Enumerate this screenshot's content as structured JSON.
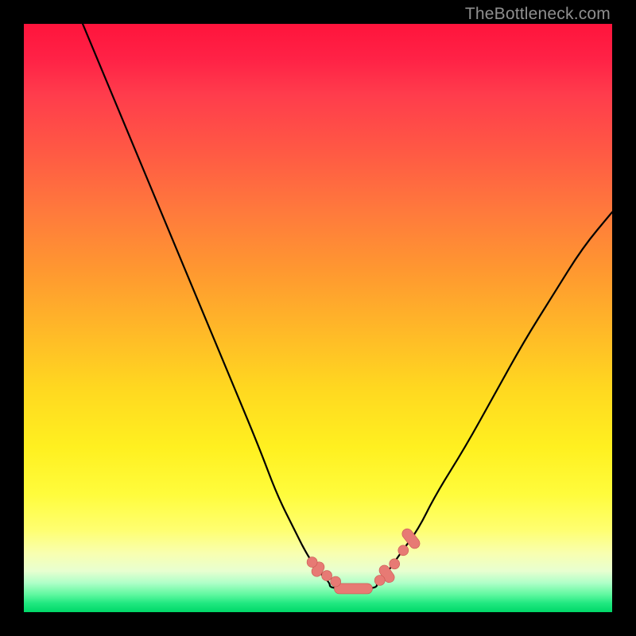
{
  "watermark": "TheBottleneck.com",
  "colors": {
    "frame": "#000000",
    "curve_stroke": "#000000",
    "marker_fill": "#e77a74",
    "marker_stroke": "#c95650",
    "watermark_text": "#8f8f8f"
  },
  "chart_data": {
    "type": "line",
    "title": "",
    "xlabel": "",
    "ylabel": "",
    "xlim": [
      0,
      100
    ],
    "ylim": [
      0,
      100
    ],
    "grid": false,
    "legend": false,
    "note": "No numeric axis ticks or data labels are visible; values are estimated from pixel positions of the curve and markers (0–100 normalized).",
    "series": [
      {
        "name": "left-branch",
        "type": "line",
        "x": [
          10,
          15,
          20,
          25,
          30,
          35,
          40,
          43,
          46,
          48,
          50,
          52
        ],
        "y": [
          100,
          88,
          76,
          64,
          52,
          40,
          28,
          20,
          14,
          10,
          7,
          5
        ]
      },
      {
        "name": "right-branch",
        "type": "line",
        "x": [
          60,
          62,
          64,
          67,
          70,
          75,
          80,
          85,
          90,
          95,
          100
        ],
        "y": [
          5,
          7,
          10,
          14,
          20,
          28,
          37,
          46,
          54,
          62,
          68
        ]
      },
      {
        "name": "flat-bottom",
        "type": "line",
        "x": [
          52,
          54,
          56,
          58,
          60
        ],
        "y": [
          4.2,
          4,
          4,
          4,
          4.2
        ]
      },
      {
        "name": "dot-markers",
        "type": "scatter",
        "x": [
          49,
          51.5,
          53,
          60.5,
          63,
          64.5
        ],
        "y": [
          8.5,
          6.2,
          5.2,
          5.4,
          8.2,
          10.5
        ]
      },
      {
        "name": "pill-markers",
        "type": "scatter",
        "note": "elongated pill-shaped markers along the curve; x/y give center, angle in degrees, length in normalized units",
        "points": [
          {
            "x": 50.0,
            "y": 7.3,
            "angle": -62,
            "len": 2.6
          },
          {
            "x": 56.0,
            "y": 4.0,
            "angle": 0,
            "len": 6.5
          },
          {
            "x": 61.7,
            "y": 6.5,
            "angle": 55,
            "len": 3.2
          },
          {
            "x": 65.8,
            "y": 12.5,
            "angle": 52,
            "len": 3.8
          }
        ]
      }
    ]
  }
}
